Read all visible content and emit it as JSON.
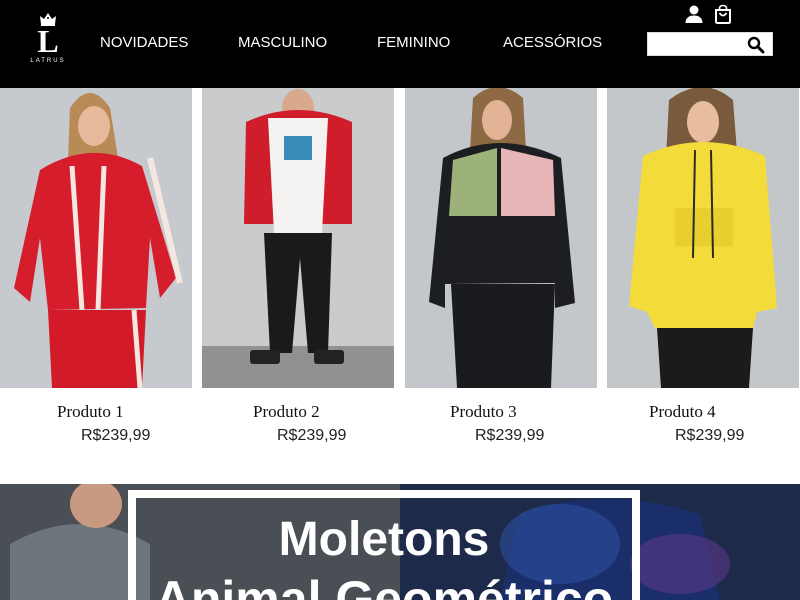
{
  "brand": {
    "logo_letter": "L",
    "logo_text": "LATRUS"
  },
  "nav": {
    "items": [
      {
        "label": "NOVIDADES"
      },
      {
        "label": "MASCULINO"
      },
      {
        "label": "FEMININO"
      },
      {
        "label": "ACESSÓRIOS"
      }
    ]
  },
  "header_icons": {
    "account": "user-icon",
    "cart": "shopping-bag-icon",
    "search": "search-icon"
  },
  "search": {
    "value": "",
    "placeholder": ""
  },
  "products": [
    {
      "name": "Produto 1",
      "price": "R$239,99",
      "garment_color": "#d61d2c"
    },
    {
      "name": "Produto 2",
      "price": "R$239,99",
      "garment_color": "#cc1d2a"
    },
    {
      "name": "Produto 3",
      "price": "R$239,99",
      "garment_color": "#1c1e22"
    },
    {
      "name": "Produto 4",
      "price": "R$239,99",
      "garment_color": "#f3dc3a"
    }
  ],
  "banner": {
    "title": "Moletons",
    "subtitle": "Animal Geométrico"
  },
  "colors": {
    "header_bg": "#000000",
    "header_text": "#ffffff",
    "photo_bg": "#c5c8cc",
    "banner_bg": "#3d4552"
  }
}
